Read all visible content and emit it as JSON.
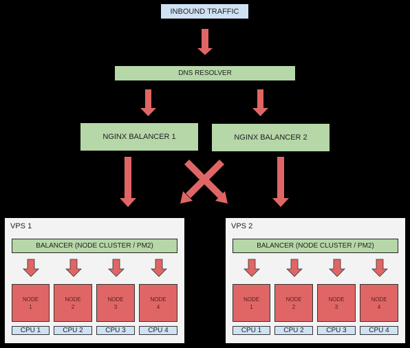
{
  "diagram": {
    "inbound": "INBOUND TRAFFIC",
    "dns": "DNS RESOLVER",
    "nginx": [
      "NGINX BALANCER 1",
      "NGINX BALANCER 2"
    ],
    "vps": [
      {
        "label": "VPS 1",
        "balancer": "BALANCER (NODE CLUSTER / PM2)",
        "nodes": [
          {
            "title": "NODE",
            "num": "1",
            "cpu": "CPU 1"
          },
          {
            "title": "NODE",
            "num": "2",
            "cpu": "CPU 2"
          },
          {
            "title": "NODE",
            "num": "3",
            "cpu": "CPU 3"
          },
          {
            "title": "NODE",
            "num": "4",
            "cpu": "CPU 4"
          }
        ]
      },
      {
        "label": "VPS 2",
        "balancer": "BALANCER (NODE CLUSTER / PM2)",
        "nodes": [
          {
            "title": "NODE",
            "num": "1",
            "cpu": "CPU 1"
          },
          {
            "title": "NODE",
            "num": "2",
            "cpu": "CPU 2"
          },
          {
            "title": "NODE",
            "num": "3",
            "cpu": "CPU 3"
          },
          {
            "title": "NODE",
            "num": "4",
            "cpu": "CPU 4"
          }
        ]
      }
    ],
    "colors": {
      "background": "#000000",
      "arrow": "#e06666",
      "traffic_box": "#cfe2f3",
      "balancer_box": "#b6d7a8",
      "node_box": "#e06666",
      "vps_panel": "#f3f3f3"
    }
  }
}
